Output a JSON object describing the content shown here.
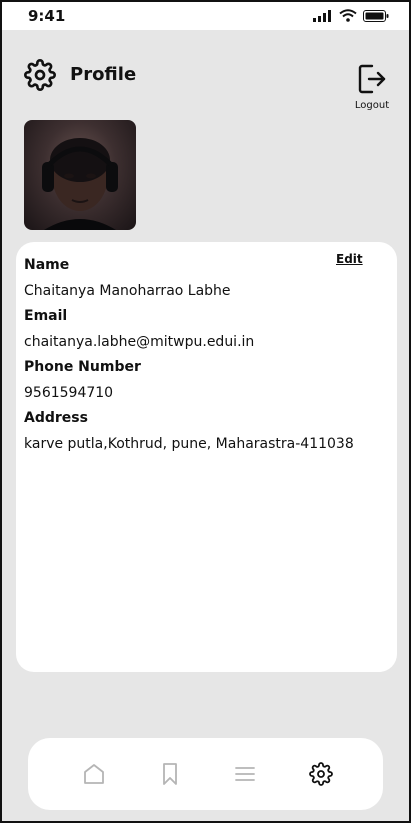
{
  "status_bar": {
    "time": "9:41"
  },
  "header": {
    "title": "Profile",
    "logout_label": "Logout"
  },
  "profile": {
    "edit_label": "Edit",
    "fields": [
      {
        "label": "Name",
        "value": "Chaitanya Manoharrao Labhe"
      },
      {
        "label": "Email",
        "value": "chaitanya.labhe@mitwpu.edui.in"
      },
      {
        "label": "Phone Number",
        "value": "9561594710"
      },
      {
        "label": "Address",
        "value": "karve putla,Kothrud, pune, Maharastra-411038"
      }
    ]
  },
  "bottom_nav": {
    "items": [
      {
        "icon": "home-icon",
        "active": false
      },
      {
        "icon": "bookmark-icon",
        "active": false
      },
      {
        "icon": "menu-icon",
        "active": false
      },
      {
        "icon": "gear-icon",
        "active": true
      }
    ]
  },
  "colors": {
    "background": "#e6e6e6",
    "card": "#ffffff",
    "text": "#111111",
    "inactive_icon": "#b5b5b5"
  }
}
